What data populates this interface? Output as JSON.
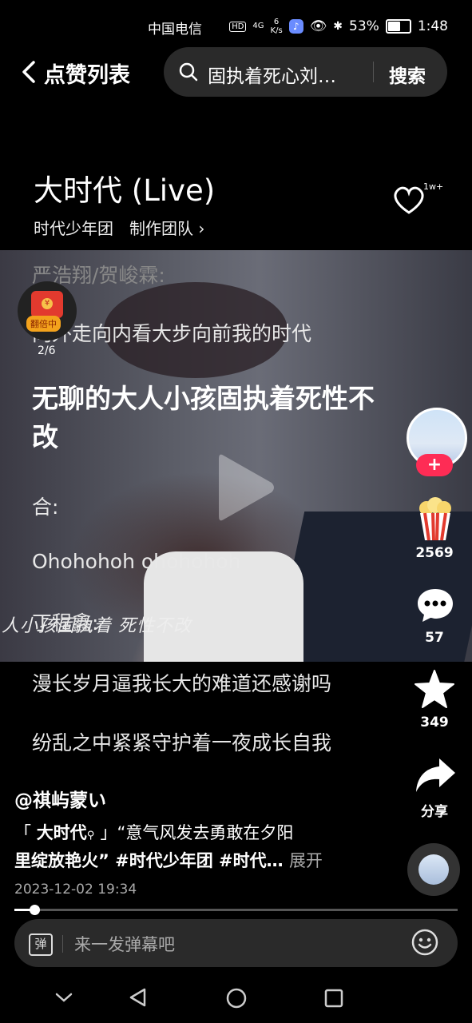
{
  "status_bar": {
    "carrier": "中国电信",
    "hd": "HD",
    "signal": "4G",
    "net_speed_value": "6",
    "net_speed_unit": "K/s",
    "battery_pct": "53%",
    "battery_level": 0.53,
    "time": "1:48"
  },
  "header": {
    "back_icon": "chevron-left-icon",
    "title": "点赞列表",
    "search_query": "固执着死心刘…",
    "search_button": "搜索"
  },
  "song": {
    "title": "大时代 (Live)",
    "artist": "时代少年团",
    "credits": "制作团队",
    "like_count": "1w+"
  },
  "lyrics": {
    "top_dim": "严浩翔/贺峻霖:",
    "line1": "向外走向内看大步向前我的时代",
    "current": "无聊的大人小孩固执着死性不改",
    "part": "合:",
    "line3": "Ohohohoh ohohohoh",
    "line4": "丁程鑫:",
    "line5": "漫长岁月逼我长大的难道还感谢吗",
    "line6": "纷乱之中紧紧守护着一夜成长自我"
  },
  "video": {
    "burned_subtitle": "人小孩固执着  死性不改"
  },
  "red_packet": {
    "badge": "翻倍中",
    "progress": "2/6"
  },
  "rail": {
    "follow_label": "+",
    "popcorn_count": "2569",
    "comment_count": "57",
    "favorite_count": "349",
    "share_label": "分享"
  },
  "post": {
    "author": "@祺屿蒙い",
    "desc_line1_prefix": "「",
    "desc_topic": "大时代",
    "desc_line1_suffix": "」“意气风发去勇敢在夕阳",
    "desc_line2": "里绽放艳火” #时代少年团 #时代…",
    "expand": "展开",
    "date": "2023-12-02 19:34",
    "progress_fraction": 0.045
  },
  "danmaku": {
    "toggle_label": "弹",
    "placeholder": "来一发弹幕吧"
  },
  "colors": {
    "accent_red": "#fe2c55",
    "background": "#000000",
    "search_bg": "#2a2a2a"
  }
}
